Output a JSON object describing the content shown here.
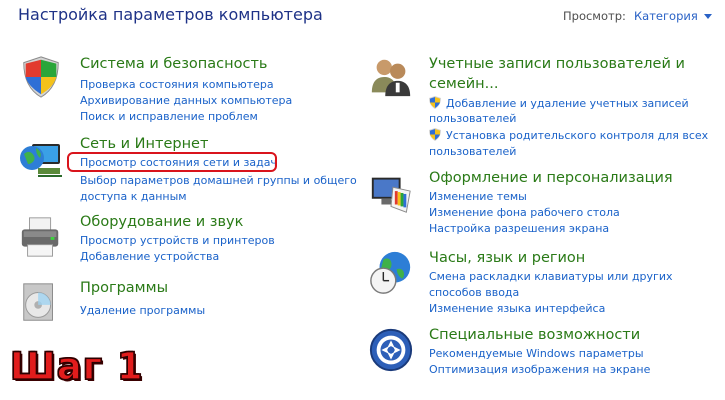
{
  "header": {
    "title": "Настройка параметров компьютера",
    "view_label": "Просмотр:",
    "view_value": "Категория"
  },
  "categories": {
    "system": {
      "title": "Система и безопасность",
      "icon": "shield-security-icon",
      "links": [
        "Проверка состояния компьютера",
        "Архивирование данных компьютера",
        "Поиск и исправление проблем"
      ]
    },
    "network": {
      "title": "Сеть и Интернет",
      "icon": "network-globe-icon",
      "links": [
        "Просмотр состояния сети и задач",
        "Выбор параметров домашней группы и общего",
        "доступа к данным"
      ]
    },
    "hardware": {
      "title": "Оборудование и звук",
      "icon": "printer-icon",
      "links": [
        "Просмотр устройств и принтеров",
        "Добавление устройства"
      ]
    },
    "programs": {
      "title": "Программы",
      "icon": "programs-disc-icon",
      "links": [
        "Удаление программы"
      ]
    },
    "users": {
      "title_line1": "Учетные записи пользователей и",
      "title_line2": "семейн...",
      "icon": "users-icon",
      "links": [
        "Добавление и удаление учетных записей",
        "пользователей",
        "Установка родительского контроля для всех",
        "пользователей"
      ]
    },
    "appearance": {
      "title": "Оформление и персонализация",
      "icon": "monitor-palette-icon",
      "links": [
        "Изменение темы",
        "Изменение фона рабочего стола",
        "Настройка разрешения экрана"
      ]
    },
    "clock": {
      "title": "Часы, язык и регион",
      "icon": "clock-globe-icon",
      "links": [
        "Смена раскладки клавиатуры или других",
        "способов ввода",
        "Изменение языка интерфейса"
      ]
    },
    "access": {
      "title": "Специальные возможности",
      "icon": "accessibility-icon",
      "links": [
        "Рекомендуемые Windows параметры",
        "Оптимизация изображения на экране"
      ]
    }
  },
  "step_label": "Шаг 1",
  "colors": {
    "header": "#1e3287",
    "category_title": "#2a7a17",
    "link": "#1a62c9",
    "highlight": "#d9141c",
    "step": "#e21c1c"
  }
}
